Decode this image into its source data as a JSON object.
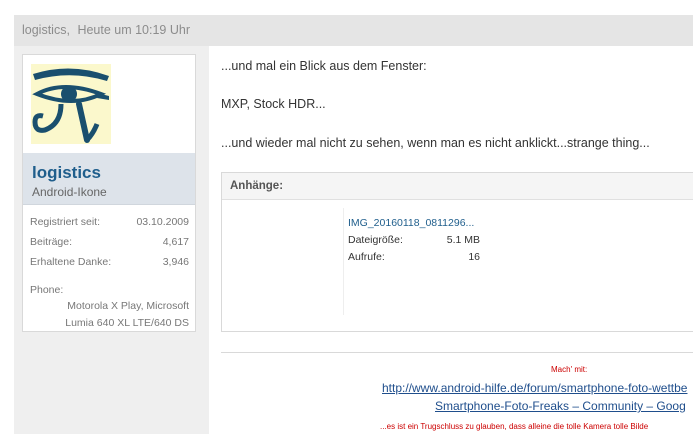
{
  "post_header": {
    "author": "logistics",
    "separator": ",",
    "time": "Heute um 10:19 Uhr"
  },
  "user": {
    "avatar_icon": "eye-of-horus-icon",
    "name": "logistics",
    "title": "Android-Ikone",
    "stats": [
      {
        "label": "Registriert seit:",
        "value": "03.10.2009"
      },
      {
        "label": "Beiträge:",
        "value": "4,617"
      },
      {
        "label": "Erhaltene Danke:",
        "value": "3,946"
      }
    ],
    "phone_label": "Phone:",
    "phone_value": "Motorola X Play, Microsoft Lumia 640 XL LTE/640 DS"
  },
  "message": {
    "line1": "...und mal ein Blick aus dem Fenster:",
    "line2": "MXP, Stock HDR...",
    "line3": "...und wieder mal nicht zu sehen, wenn man es nicht anklickt...strange thing..."
  },
  "attachments": {
    "heading": "Anhänge:",
    "file_name": "IMG_20160118_0811296...",
    "size_label": "Dateigröße:",
    "size_value": "5.1 MB",
    "views_label": "Aufrufe:",
    "views_value": "16"
  },
  "signature": {
    "mach_mit": "Mach' mit:",
    "link1": "http://www.android-hilfe.de/forum/smartphone-foto-wettbe",
    "link2": "Smartphone-Foto-Freaks – Community – Goog",
    "note": "...es ist ein Trugschluss zu glauben, dass alleine die tolle Kamera tolle Bilde"
  },
  "colors": {
    "username": "#1f5e8c",
    "link": "#1f4e8c",
    "signature_red": "#cc0000",
    "header_bg": "#e5e5e5"
  }
}
